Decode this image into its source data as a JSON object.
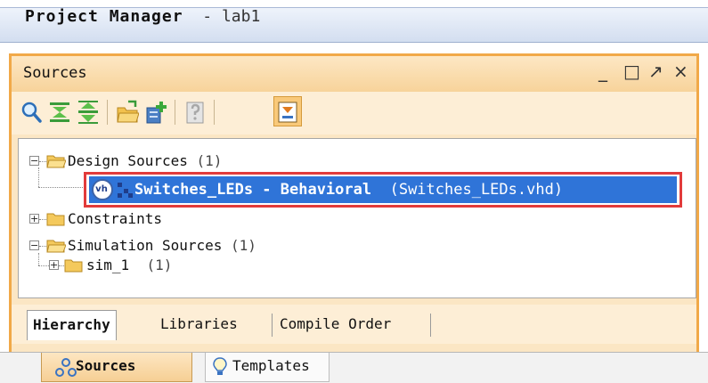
{
  "header": {
    "title": "Project Manager",
    "separator": "-",
    "project": "lab1"
  },
  "sources_panel": {
    "title": "Sources",
    "window_buttons": {
      "minimize": "_",
      "maximize": "□",
      "float": "↗",
      "close": "×"
    }
  },
  "tree": {
    "design_sources": {
      "label": "Design Sources",
      "count": "(1)"
    },
    "design_child": {
      "label": "Switches_LEDs - Behavioral",
      "file": "(Switches_LEDs.vhd)",
      "badge": "vh"
    },
    "constraints": {
      "label": "Constraints"
    },
    "simulation_sources": {
      "label": "Simulation Sources",
      "count": "(1)"
    },
    "sim_child": {
      "label": "sim_1",
      "count": "(1)"
    }
  },
  "panel_tabs": [
    "Hierarchy",
    "Libraries",
    "Compile Order"
  ],
  "bottom_tabs": [
    "Sources",
    "Templates"
  ],
  "colors": {
    "accent_orange": "#f1a948",
    "selection_blue": "#2f74d8",
    "highlight_red": "#e23b3b"
  }
}
